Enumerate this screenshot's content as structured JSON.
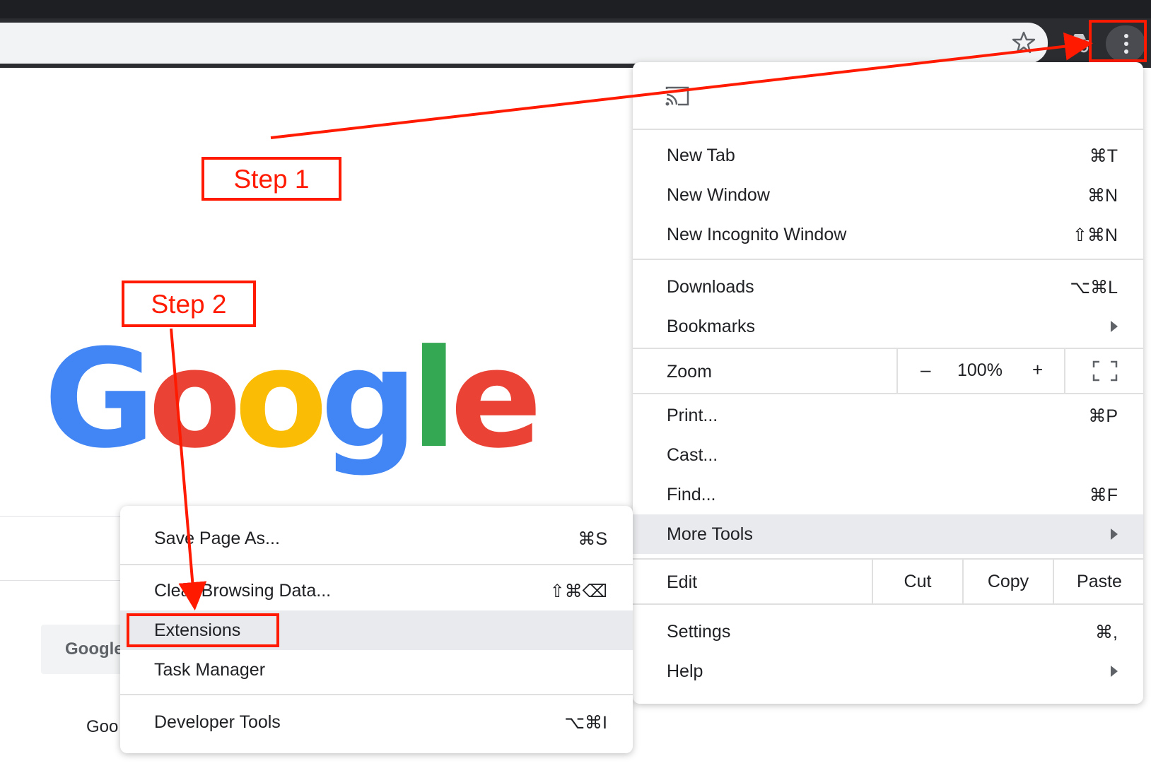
{
  "browser": {
    "toolbar": {
      "star_icon": "star-icon",
      "incognito_icon": "incognito-icon",
      "menu_icon": "three-dots-icon"
    }
  },
  "page": {
    "logo_letters": [
      "G",
      "o",
      "o",
      "g",
      "l",
      "e"
    ],
    "logo_colors": [
      "#4285F4",
      "#EA4335",
      "#FBBC05",
      "#4285F4",
      "#34A853",
      "#EA4335"
    ],
    "button_partial": "Google",
    "footer_partial": "Goo"
  },
  "menu": {
    "cast_icon": "cast-icon",
    "new_tab": {
      "label": "New Tab",
      "shortcut": "⌘T"
    },
    "new_window": {
      "label": "New Window",
      "shortcut": "⌘N"
    },
    "new_incognito": {
      "label": "New Incognito Window",
      "shortcut": "⇧⌘N"
    },
    "downloads": {
      "label": "Downloads",
      "shortcut": "⌥⌘L"
    },
    "bookmarks": {
      "label": "Bookmarks"
    },
    "zoom": {
      "label": "Zoom",
      "minus": "–",
      "value": "100%",
      "plus": "+"
    },
    "print": {
      "label": "Print...",
      "shortcut": "⌘P"
    },
    "cast": {
      "label": "Cast..."
    },
    "find": {
      "label": "Find...",
      "shortcut": "⌘F"
    },
    "more_tools": {
      "label": "More Tools"
    },
    "edit": {
      "label": "Edit",
      "cut": "Cut",
      "copy": "Copy",
      "paste": "Paste"
    },
    "settings": {
      "label": "Settings",
      "shortcut": "⌘,"
    },
    "help": {
      "label": "Help"
    }
  },
  "submenu": {
    "save_page": {
      "label": "Save Page As...",
      "shortcut": "⌘S"
    },
    "clear_browsing": {
      "label": "Clear Browsing Data...",
      "shortcut": "⇧⌘⌫"
    },
    "extensions": {
      "label": "Extensions"
    },
    "task_manager": {
      "label": "Task Manager"
    },
    "developer_tools": {
      "label": "Developer Tools",
      "shortcut": "⌥⌘I"
    }
  },
  "annotations": {
    "step1": "Step 1",
    "step2": "Step 2",
    "color": "#FF1A00"
  }
}
